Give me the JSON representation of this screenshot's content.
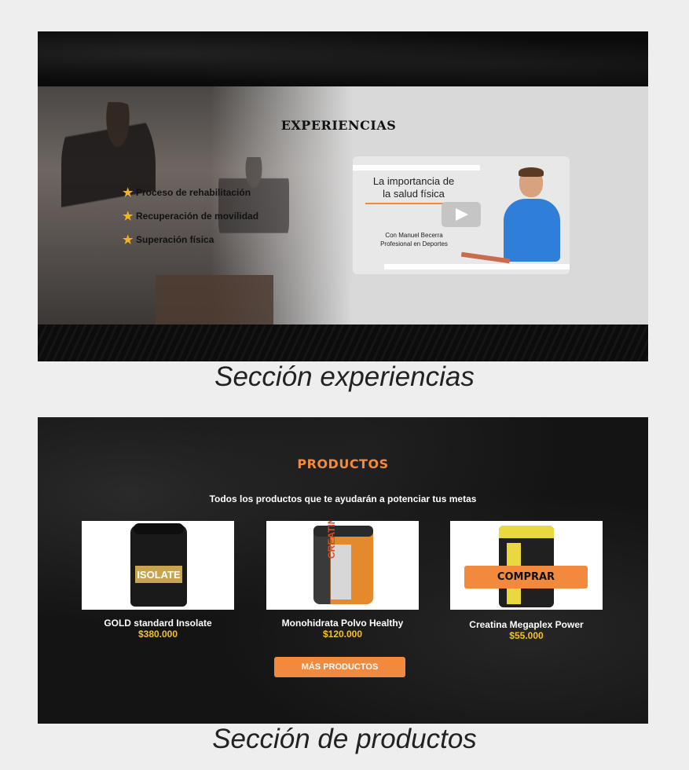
{
  "experiences": {
    "title": "EXPERIENCIAS",
    "items": [
      {
        "label": "Proceso de rehabilitación",
        "icon": "star-icon"
      },
      {
        "label": "Recuperación de movilidad",
        "icon": "star-icon"
      },
      {
        "label": "Superación física",
        "icon": "star-icon"
      }
    ],
    "video": {
      "title_line1": "La importancia de",
      "title_line2": "la salud física",
      "subtitle_line1": "Con Manuel Becerra",
      "subtitle_line2": "Profesional en Deportes",
      "play_icon": "play-icon"
    },
    "caption": "Sección experiencias"
  },
  "products": {
    "title": "PRODUCTOS",
    "subtitle": "Todos los productos que te ayudarán a potenciar tus metas",
    "items": [
      {
        "name": "GOLD standard Insolate",
        "price": "$380.000",
        "image_text": "ISOLATE"
      },
      {
        "name": "Monohidrata Polvo Healthy",
        "price": "$120.000",
        "image_text": "CREATINE"
      },
      {
        "name": "Creatina Megaplex Power",
        "price": "$55.000"
      }
    ],
    "buy_label": "COMPRAR",
    "more_label": "MÁS PRODUCTOS",
    "caption": "Sección de productos"
  },
  "colors": {
    "accent": "#f28a3e",
    "price": "#f5c21b",
    "star": "#f2b51e"
  }
}
